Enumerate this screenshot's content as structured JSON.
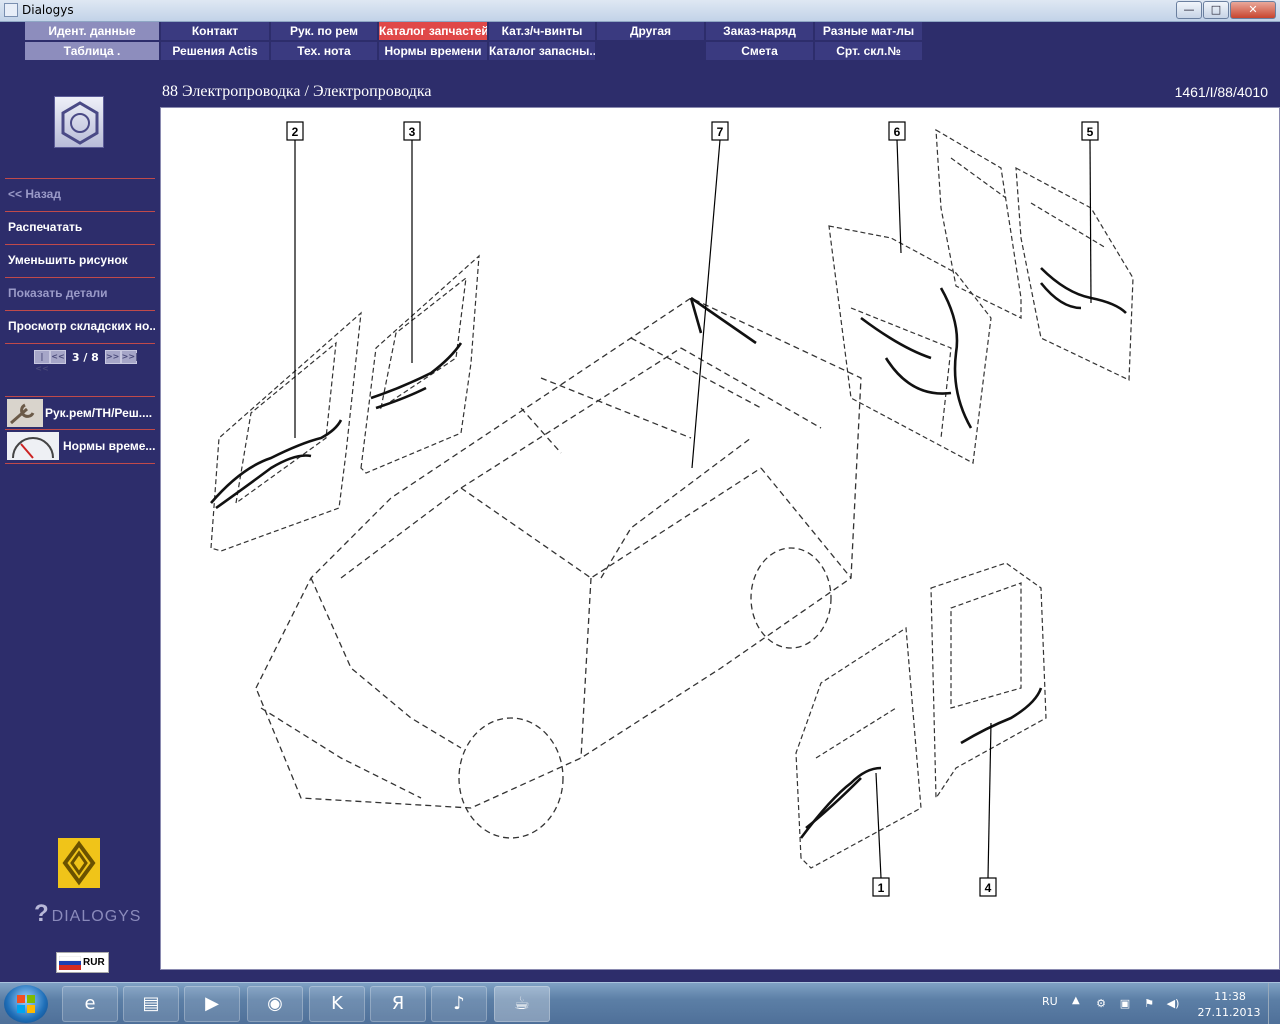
{
  "window": {
    "title": "Dialogys",
    "minimize": "—",
    "maximize": "□",
    "close": "✕"
  },
  "nav": {
    "row1": [
      "Идент. данные",
      "Контакт",
      "Рук. по рем",
      "Каталог запчастей",
      "Кат.з/ч-винты",
      "Другая",
      "Заказ-наряд",
      "Разные мат-лы"
    ],
    "row2": [
      "Таблица .",
      "Решения Actis",
      "Тех. нота",
      "Нормы времени",
      "Каталог запасны...",
      "Смета",
      "Срт. скл.№"
    ],
    "active_tab": "Каталог запчастей",
    "colors": {
      "active": "#e04848",
      "tab": "#8d8dbd",
      "tab_dark": "#3a3a80"
    }
  },
  "header": {
    "title": "88 Электропроводка / Электропроводка",
    "code": "1461/I/88/4010"
  },
  "sidebar": {
    "items": [
      {
        "label": "<< Назад",
        "enabled": false
      },
      {
        "label": "Распечатать",
        "enabled": true
      },
      {
        "label": "Уменьшить рисунок",
        "enabled": true
      },
      {
        "label": "Показать детали",
        "enabled": false
      },
      {
        "label": "Просмотр складских но...",
        "enabled": true
      }
    ],
    "pager": {
      "first": "|<<",
      "prev": "<<",
      "current": 3,
      "total": 8,
      "text": "3 / 8",
      "next": ">>",
      "last": ">>|"
    },
    "links": [
      {
        "label": "Рук.рем/ТН/Реш....",
        "icon": "wrench-icon"
      },
      {
        "label": "Нормы време...",
        "icon": "speedometer-icon"
      }
    ],
    "brand": "DIALOGYS",
    "currency": "RUR"
  },
  "diagram": {
    "callouts": [
      "1",
      "2",
      "3",
      "4",
      "5",
      "6",
      "7"
    ]
  },
  "taskbar": {
    "apps": [
      {
        "name": "internet-explorer-icon",
        "glyph": "e"
      },
      {
        "name": "file-explorer-icon",
        "glyph": "▤"
      },
      {
        "name": "media-player-icon",
        "glyph": "▶"
      },
      {
        "name": "chrome-icon",
        "glyph": "◉"
      },
      {
        "name": "kaspersky-icon",
        "glyph": "K"
      },
      {
        "name": "yandex-icon",
        "glyph": "Я"
      },
      {
        "name": "speaker-app-icon",
        "glyph": "♪"
      },
      {
        "name": "java-icon",
        "glyph": "☕"
      }
    ],
    "tray": {
      "lang": "RU",
      "time": "11:38",
      "date": "27.11.2013"
    }
  }
}
